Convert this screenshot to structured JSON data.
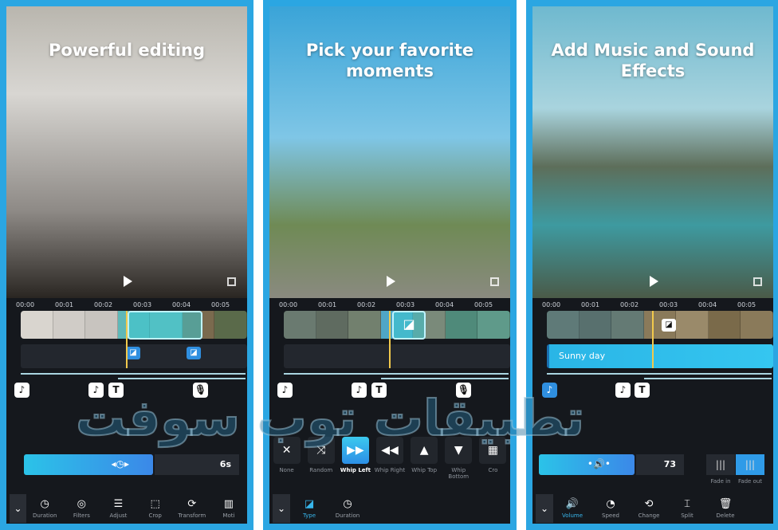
{
  "accent": "#2ba6e2",
  "watermark": "تطبيقات توب سوفت",
  "ruler": [
    "00:00",
    "00:01",
    "00:02",
    "00:03",
    "00:04",
    "00:05"
  ],
  "panels": [
    {
      "headline": "Powerful editing",
      "photo": "linear-gradient(#b9b6ae,#d8d6d2 30%,#8e8a86 70%,#2a2622)",
      "clips": [
        "#d9d5cf",
        "#d0ccc7",
        "#c8c4bf",
        "#5fb8b8",
        "#6ab9b5",
        "#7a6a4e",
        "#5a6a4a"
      ],
      "duration_value": "6s",
      "duration_fill": 0.6,
      "markers": [
        {
          "icon": "music-note-icon",
          "glyph": "♪"
        },
        {
          "icon": "music-note-icon",
          "glyph": "♪"
        },
        {
          "icon": "text-icon",
          "glyph": "T"
        },
        {
          "icon": "microphone-icon",
          "glyph": "🎙"
        }
      ],
      "tools": [
        {
          "label": "Duration",
          "icon": "clock-icon",
          "glyph": "◷"
        },
        {
          "label": "Filters",
          "icon": "filters-icon",
          "glyph": "◎"
        },
        {
          "label": "Adjust",
          "icon": "sliders-icon",
          "glyph": "☰"
        },
        {
          "label": "Crop",
          "icon": "crop-icon",
          "glyph": "⬚"
        },
        {
          "label": "Transform",
          "icon": "transform-icon",
          "glyph": "⟳"
        },
        {
          "label": "Moti",
          "icon": "motion-icon",
          "glyph": "▥"
        }
      ]
    },
    {
      "headline": "Pick your favorite moments",
      "photo": "linear-gradient(#3aa4d8,#7fc6e6 45%,#6f8a55 75%,#8a8a80)",
      "clips": [
        "#6a7a70",
        "#5f6b60",
        "#72806e",
        "#4fa6c6",
        "#7a8a7a",
        "#4f8a7a",
        "#5f9a8a"
      ],
      "transitions": [
        {
          "label": "None",
          "icon": "close-icon",
          "glyph": "✕"
        },
        {
          "label": "Random",
          "icon": "shuffle-icon",
          "glyph": "⤨"
        },
        {
          "label": "Whip Left",
          "icon": "whip-left-icon",
          "glyph": "▶▶",
          "selected": true
        },
        {
          "label": "Whip Right",
          "icon": "whip-right-icon",
          "glyph": "◀◀"
        },
        {
          "label": "Whip Top",
          "icon": "whip-top-icon",
          "glyph": "▲"
        },
        {
          "label": "Whip Bottom",
          "icon": "whip-bottom-icon",
          "glyph": "▼"
        },
        {
          "label": "Cro",
          "icon": "crossfade-icon",
          "glyph": "▦"
        }
      ],
      "markers": [
        {
          "icon": "music-note-icon",
          "glyph": "♪"
        },
        {
          "icon": "music-note-icon",
          "glyph": "♪"
        },
        {
          "icon": "text-icon",
          "glyph": "T"
        },
        {
          "icon": "microphone-icon",
          "glyph": "🎙"
        }
      ],
      "tools": [
        {
          "label": "Type",
          "icon": "transition-type-icon",
          "glyph": "◪",
          "active": true
        },
        {
          "label": "Duration",
          "icon": "clock-icon",
          "glyph": "◷"
        }
      ]
    },
    {
      "headline": "Add Music and Sound Effects",
      "photo": "linear-gradient(#6fb9cf,#a9d4de 35%,#5d6e5a 55%,#3e9aa0 75%,#4a5a48)",
      "clips": [
        "#5f7a78",
        "#58706e",
        "#647a74",
        "#8a7a5a",
        "#9a8a6a",
        "#7a6a4a",
        "#8a7a5a"
      ],
      "audio_track": "Sunny day",
      "volume_value": "73",
      "volume_fill": 0.73,
      "fade_in": "Fade in",
      "fade_out": "Fade out",
      "markers": [
        {
          "icon": "music-note-icon",
          "glyph": "♪"
        },
        {
          "icon": "music-note-icon",
          "glyph": "♪"
        },
        {
          "icon": "text-icon",
          "glyph": "T"
        }
      ],
      "tools": [
        {
          "label": "Volume",
          "icon": "volume-icon",
          "glyph": "🔊",
          "active": true
        },
        {
          "label": "Speed",
          "icon": "speedometer-icon",
          "glyph": "◔"
        },
        {
          "label": "Change",
          "icon": "replace-icon",
          "glyph": "⟲"
        },
        {
          "label": "Split",
          "icon": "split-icon",
          "glyph": "⌶"
        },
        {
          "label": "Delete",
          "icon": "trash-icon",
          "glyph": "🗑"
        }
      ]
    }
  ]
}
